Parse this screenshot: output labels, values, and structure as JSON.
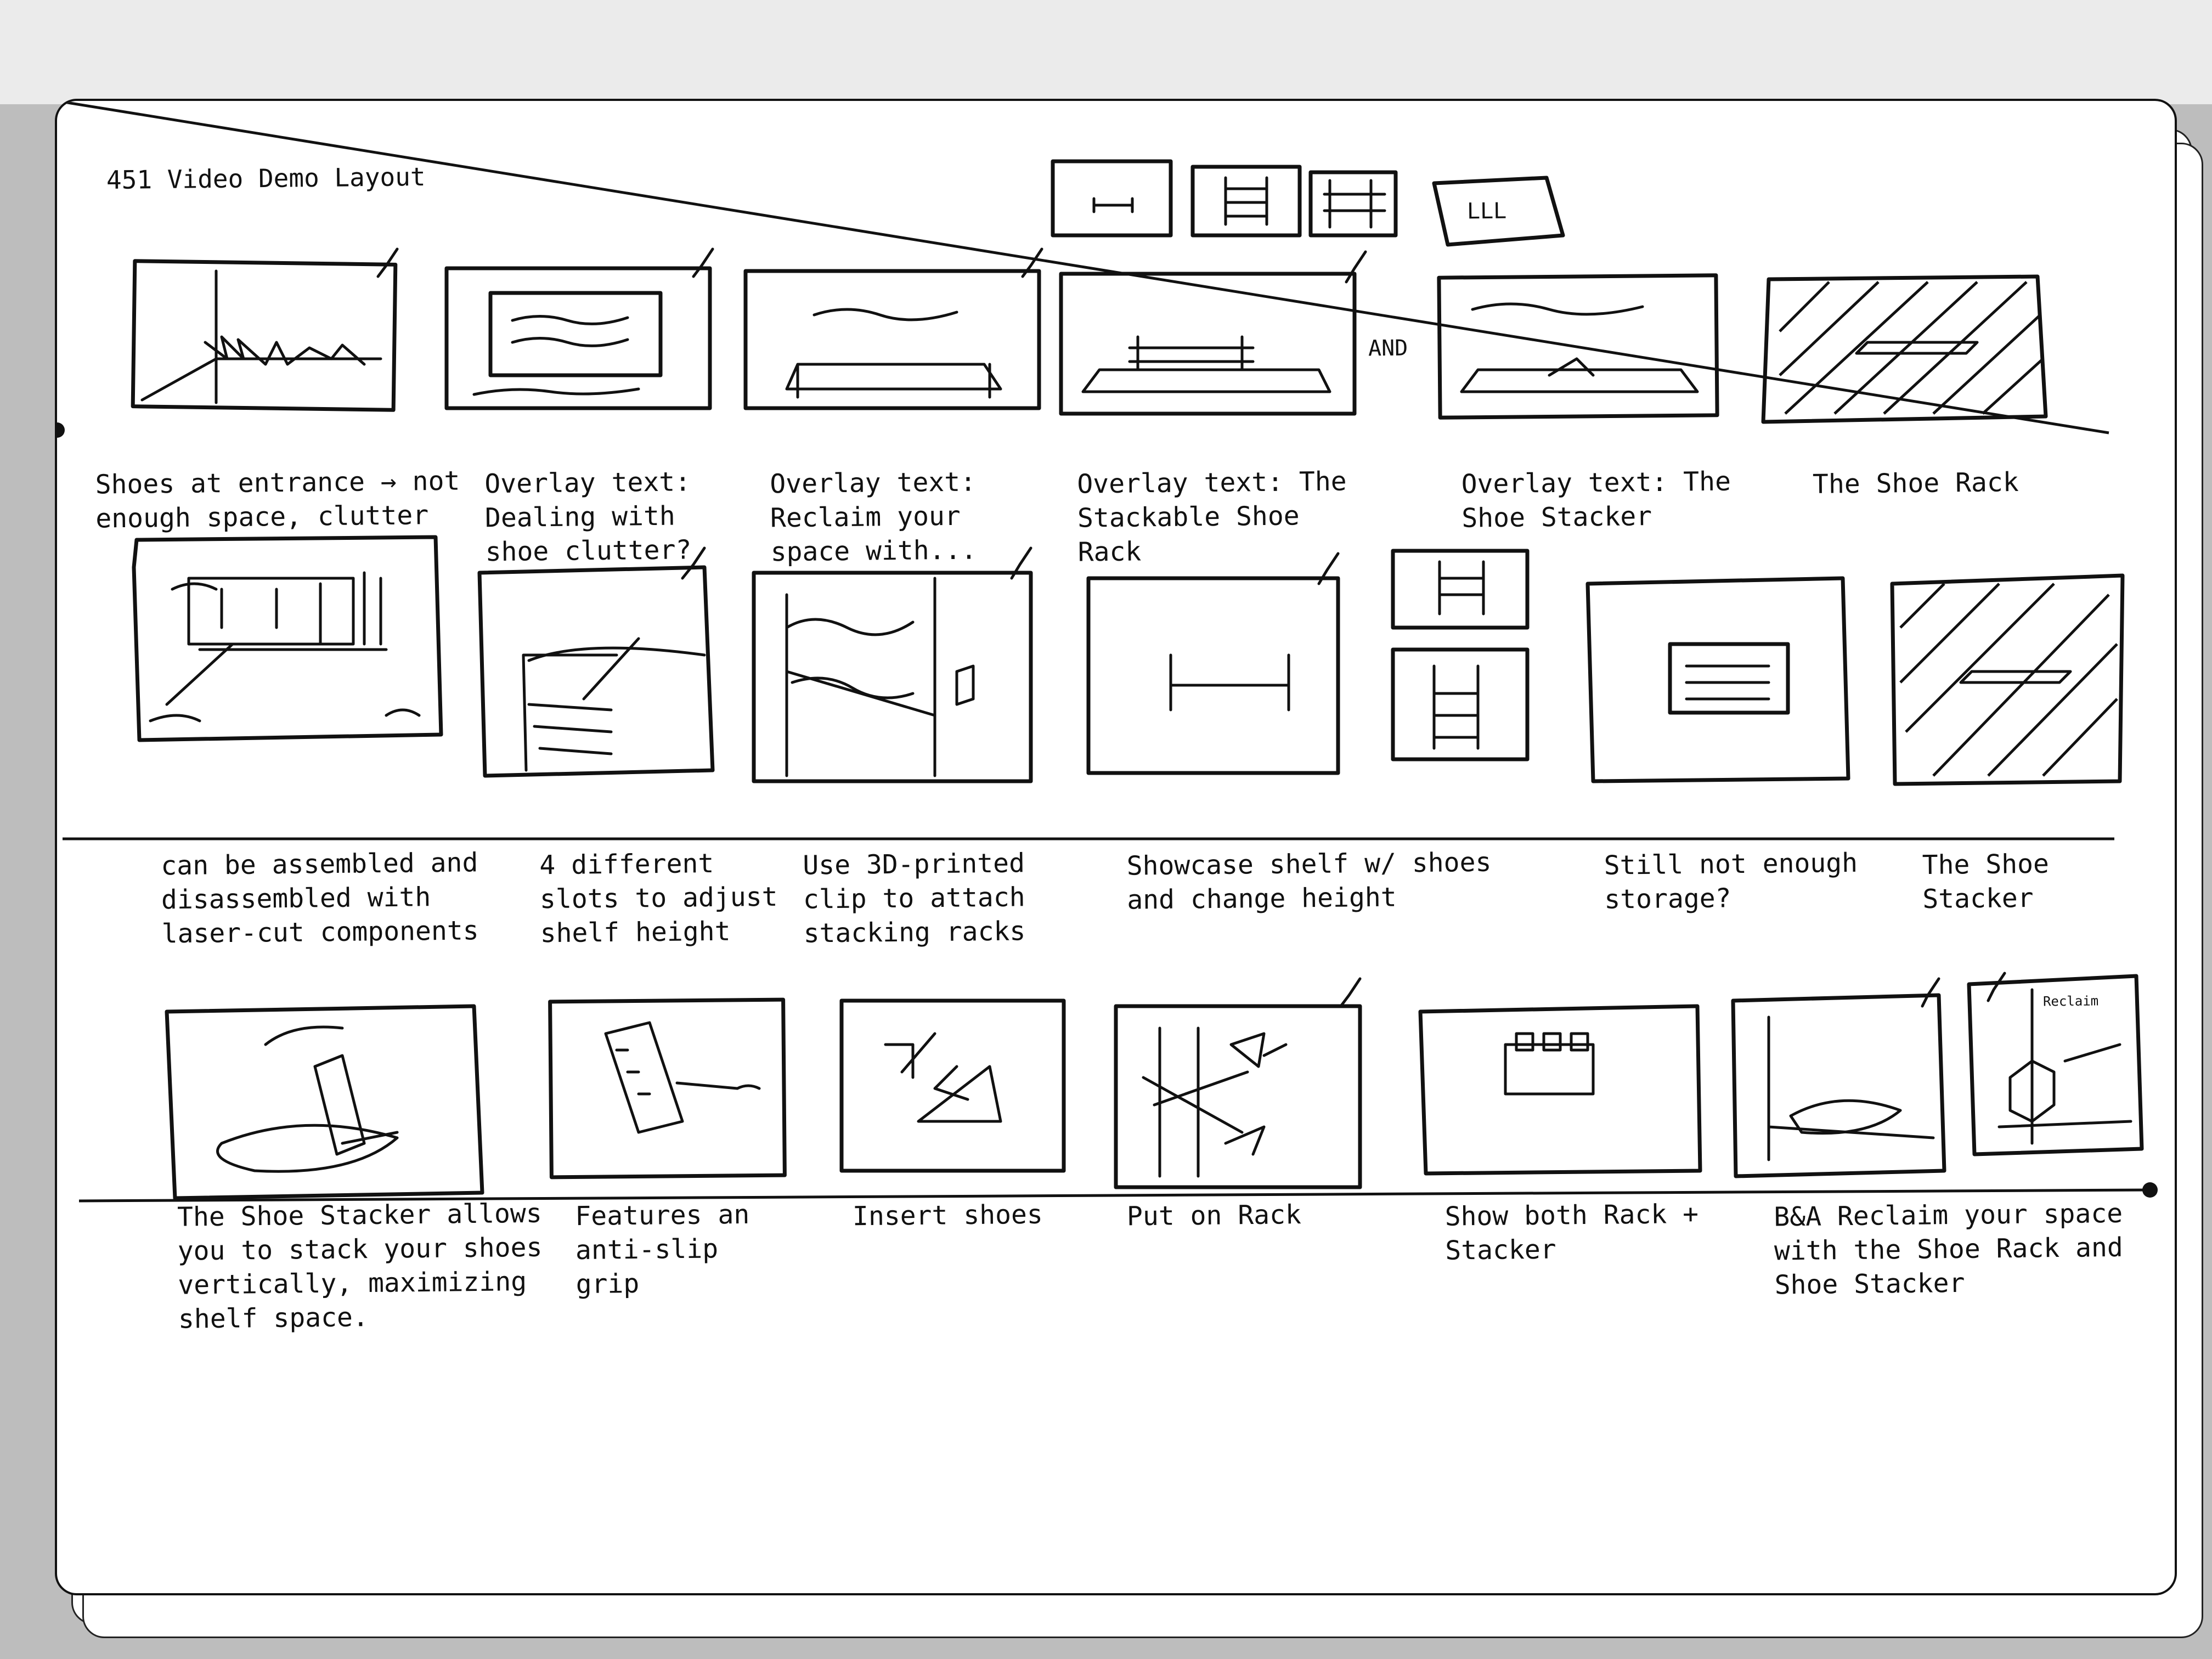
{
  "document": {
    "title": "451 Video Demo Layout",
    "aside_marks": [
      "AND",
      "LLL",
      "Reclaim"
    ]
  },
  "rows": [
    {
      "captions": [
        "Shoes at entrance → not enough space, clutter",
        "Overlay text: Dealing with shoe clutter?",
        "Overlay text: Reclaim your space with...",
        "Overlay text: The Stackable Shoe Rack",
        "Overlay text: The Shoe Stacker",
        "The Shoe Rack"
      ]
    },
    {
      "captions": [
        "can be assembled and disassembled with laser-cut components",
        "4 different slots to adjust shelf height",
        "Use 3D-printed clip to attach stacking racks",
        "Showcase shelf w/ shoes and change height",
        "Still not enough storage?",
        "The Shoe Stacker"
      ]
    },
    {
      "captions": [
        "The Shoe Stacker allows you to stack your shoes vertically, maximizing shelf space.",
        "Features an anti-slip grip",
        "Insert shoes",
        "Put on Rack",
        "Show both Rack + Stacker",
        "B&A Reclaim your space with the Shoe Rack and Shoe Stacker"
      ]
    }
  ]
}
